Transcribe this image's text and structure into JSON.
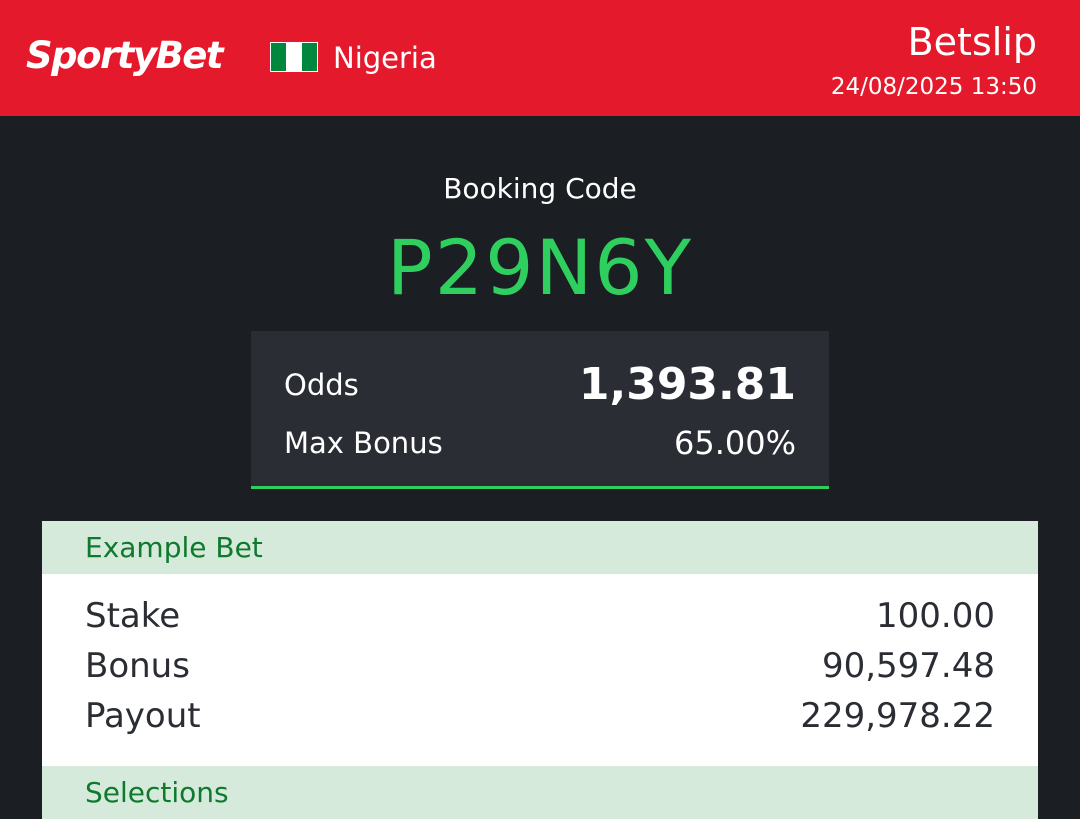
{
  "header": {
    "brand": "SportyBet",
    "country": "Nigeria",
    "title": "Betslip",
    "datetime": "24/08/2025 13:50",
    "background_color": "#e41a2c",
    "flag_icon": "nigeria-flag-icon"
  },
  "booking": {
    "label": "Booking Code",
    "code": "P29N6Y",
    "code_color": "#2fcf5f"
  },
  "summary": {
    "odds_label": "Odds",
    "odds_value": "1,393.81",
    "max_bonus_label": "Max Bonus",
    "max_bonus_value": "65.00%"
  },
  "example_bet": {
    "title": "Example Bet",
    "rows": [
      {
        "label": "Stake",
        "value": "100.00"
      },
      {
        "label": "Bonus",
        "value": "90,597.48"
      },
      {
        "label": "Payout",
        "value": "229,978.22"
      }
    ]
  },
  "selections": {
    "title": "Selections"
  }
}
